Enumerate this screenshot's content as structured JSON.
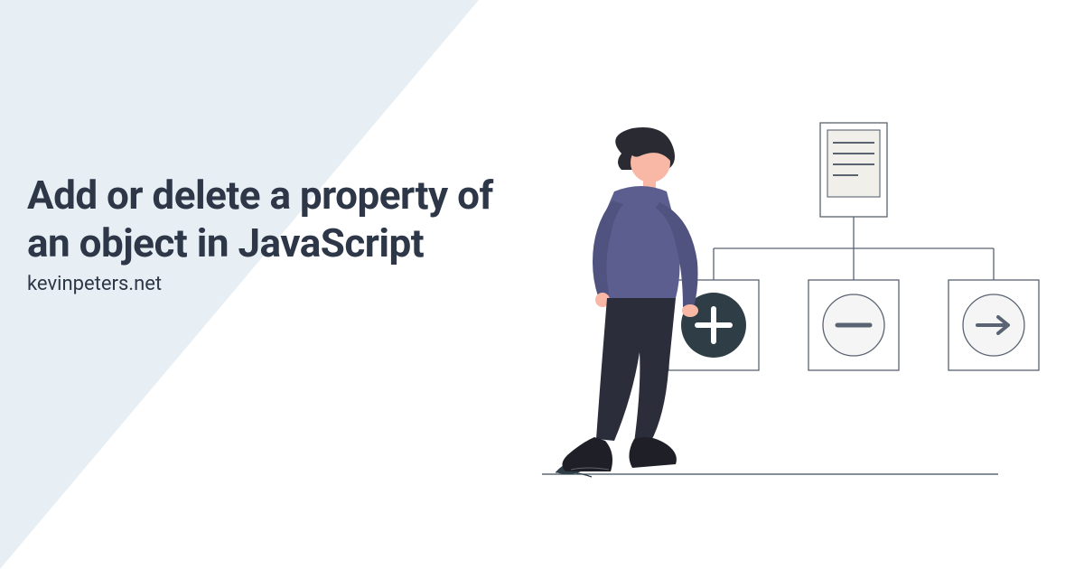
{
  "title": "Add or delete a property of an object in JavaScript",
  "site": "kevinpeters.net",
  "colors": {
    "bg_accent": "#e8eff4",
    "text": "#2d3748",
    "stroke": "#3f4b5b",
    "hair": "#2a2b32",
    "skin": "#f9b8a6",
    "shirt": "#5b5e8e",
    "pants": "#2b2d3b",
    "shoes": "#1f2027",
    "plus_fill": "#2f3e46",
    "circle_fill": "#f5f5f5"
  },
  "icons": {
    "doc": "document-icon",
    "plus": "plus-icon",
    "minus": "minus-icon",
    "arrow": "arrow-right-icon"
  }
}
